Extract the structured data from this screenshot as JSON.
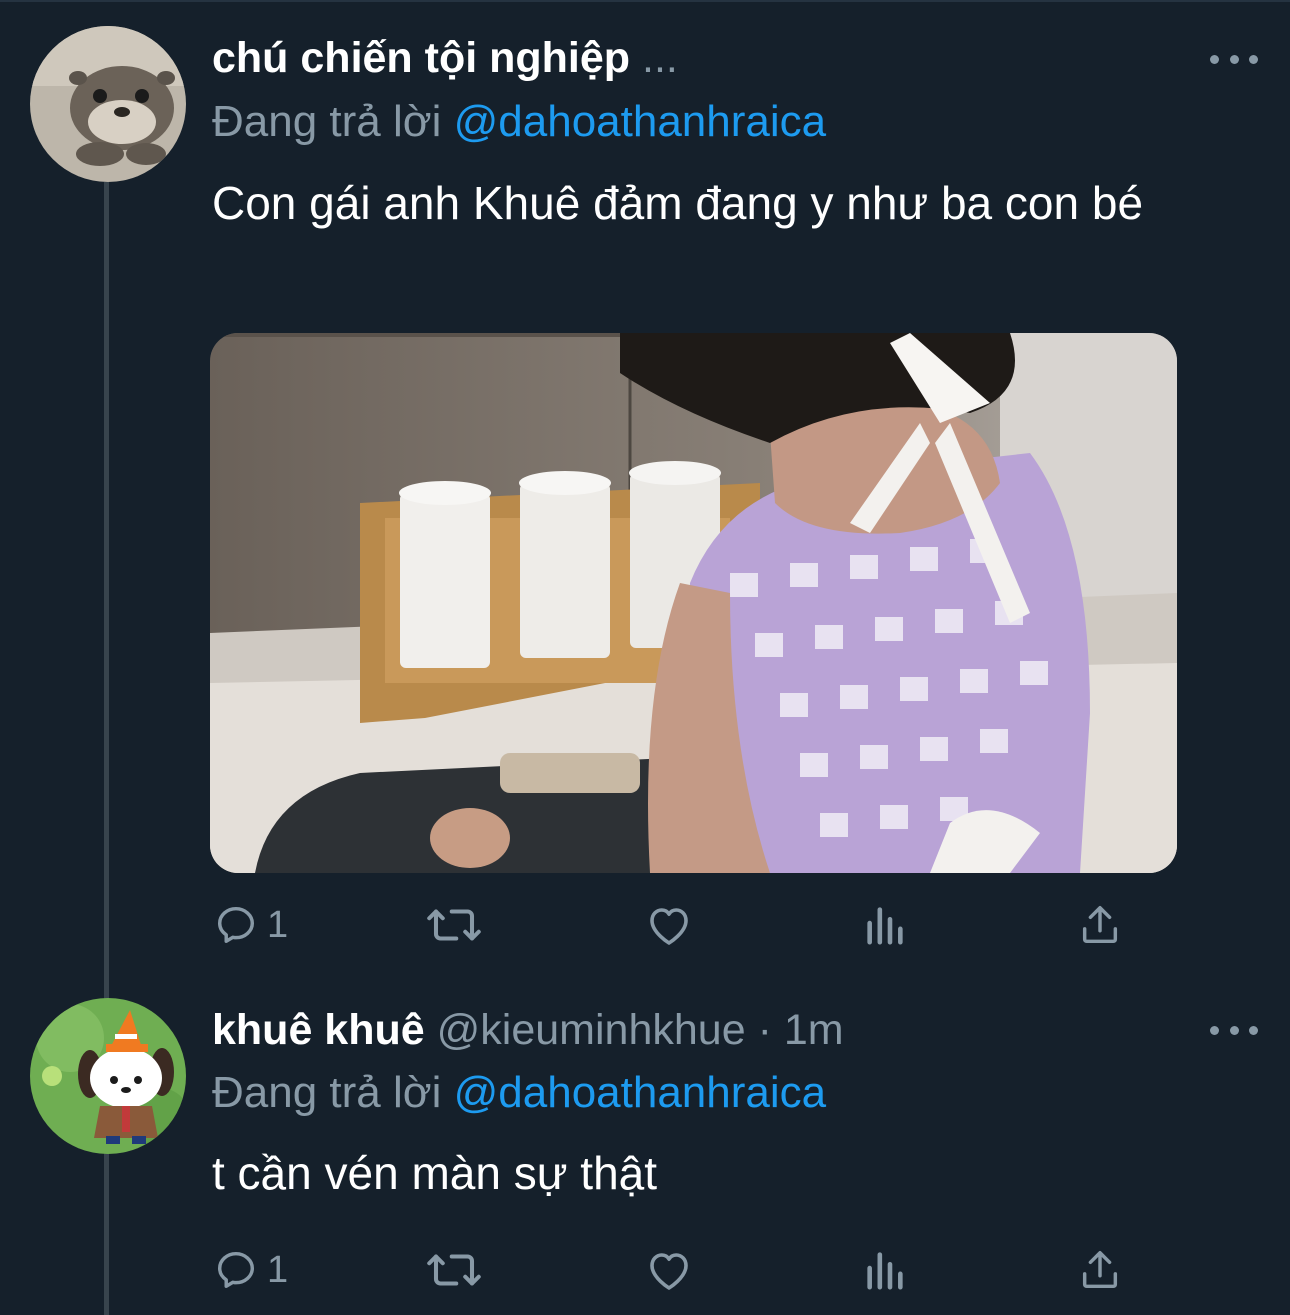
{
  "tweets": [
    {
      "display_name": "chú chiến tội nghiệp",
      "truncation": "...",
      "reply_label": "Đang trả lời",
      "reply_to": "@dahoathanhraica",
      "text": "Con gái anh Khuê đảm đang y như ba con bé",
      "reply_count": "1",
      "avatar_icon": "otter-avatar",
      "has_media": true
    },
    {
      "display_name": "khuê khuê",
      "handle": "@kieuminhkhue",
      "separator": "·",
      "time": "1m",
      "reply_label": "Đang trả lời",
      "reply_to": "@dahoathanhraica",
      "text": "t cần vén màn sự thật",
      "reply_count": "1",
      "avatar_icon": "cartoon-dog-avatar"
    }
  ],
  "colors": {
    "background": "#15202b",
    "muted": "#8899a6",
    "accent": "#1d9bf0",
    "thread_line": "#38444d"
  },
  "icons": [
    "reply-icon",
    "retweet-icon",
    "like-icon",
    "analytics-icon",
    "share-icon",
    "more-icon"
  ]
}
